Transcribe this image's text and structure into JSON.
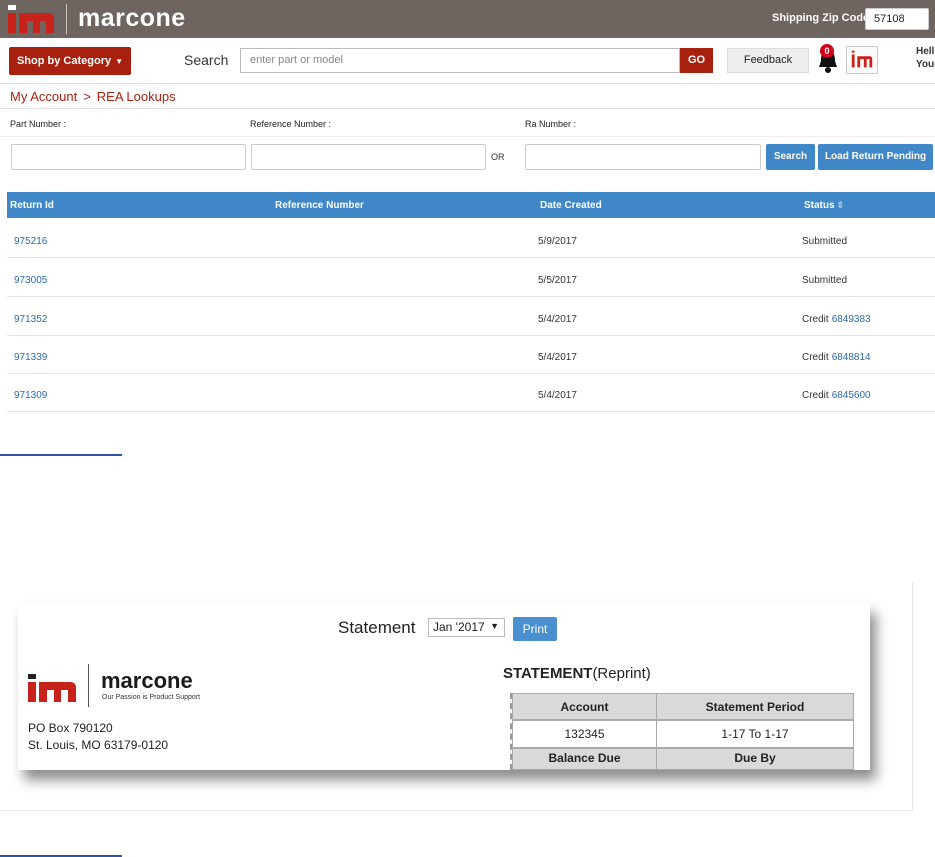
{
  "header": {
    "brand": "marcone",
    "zip_label": "Shipping Zip Code",
    "zip_value": "57108"
  },
  "nav": {
    "shop_label": "Shop by Category",
    "search_label": "Search",
    "search_placeholder": "enter part or model",
    "go_label": "GO",
    "feedback_label": "Feedback",
    "notification_count": "0",
    "hello_line1": "Hell",
    "hello_line2": "Your"
  },
  "breadcrumb": {
    "account": "My Account",
    "separator": ">",
    "current": "REA Lookups"
  },
  "filters": {
    "part_label": "Part Number :",
    "reference_label": "Reference Number :",
    "ra_label": "Ra Number :",
    "or_text": "OR",
    "search_button": "Search",
    "load_button": "Load Return Pending"
  },
  "table": {
    "columns": [
      "Return Id",
      "Reference Number",
      "Date Created",
      "Status"
    ],
    "rows": [
      {
        "return_id": "975216",
        "reference": "",
        "date": "5/9/2017",
        "status": "Submitted",
        "credit": ""
      },
      {
        "return_id": "973005",
        "reference": "",
        "date": "5/5/2017",
        "status": "Submitted",
        "credit": ""
      },
      {
        "return_id": "971352",
        "reference": "",
        "date": "5/4/2017",
        "status": "Credit",
        "credit": "6849383"
      },
      {
        "return_id": "971339",
        "reference": "",
        "date": "5/4/2017",
        "status": "Credit",
        "credit": "6848814"
      },
      {
        "return_id": "971309",
        "reference": "",
        "date": "5/4/2017",
        "status": "Credit",
        "credit": "6845600"
      }
    ]
  },
  "statement": {
    "title": "Statement",
    "period_select": "Jan '2017",
    "print_label": "Print",
    "brand": "marcone",
    "tagline": "Our Passion is Product Support",
    "address_line1": "PO Box 790120",
    "address_line2": "St. Louis, MO 63179-0120",
    "heading": "STATEMENT",
    "heading_suffix": "(Reprint)",
    "account_header": "Account",
    "period_header": "Statement Period",
    "account_value": "132345",
    "period_value": "1-17 To 1-17",
    "balance_header": "Balance Due",
    "due_header": "Due By"
  },
  "colors": {
    "brand_red": "#a8210f",
    "header_gray": "#6e6460",
    "table_blue": "#3f87c6",
    "link_blue": "#2a6bb0"
  }
}
